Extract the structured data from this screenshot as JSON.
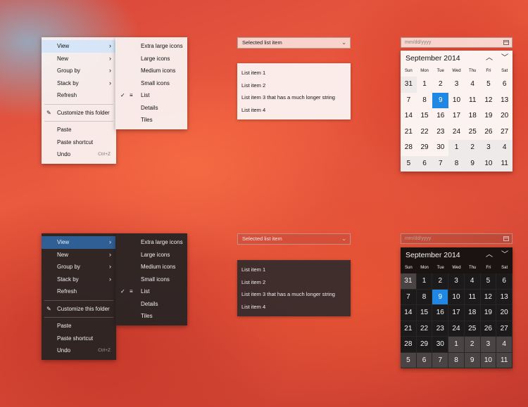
{
  "context_menu": {
    "items": [
      {
        "label": "View",
        "has_submenu": true,
        "highlighted": true
      },
      {
        "label": "New",
        "has_submenu": true
      },
      {
        "label": "Group by",
        "has_submenu": true
      },
      {
        "label": "Stack by",
        "has_submenu": true
      },
      {
        "label": "Refresh"
      },
      {
        "label": "Customize this folder",
        "icon": "customize-icon"
      },
      {
        "label": "Paste"
      },
      {
        "label": "Paste shortcut"
      },
      {
        "label": "Undo",
        "shortcut": "Ctrl+Z"
      }
    ]
  },
  "view_submenu": {
    "items": [
      {
        "label": "Extra large icons"
      },
      {
        "label": "Large icons"
      },
      {
        "label": "Medium icons"
      },
      {
        "label": "Small icons"
      },
      {
        "label": "List",
        "checked": true,
        "icon": "list-icon"
      },
      {
        "label": "Details"
      },
      {
        "label": "Tiles"
      }
    ]
  },
  "combo_box": {
    "selected": "Selected list item"
  },
  "list_box": {
    "items": [
      "List item 1",
      "List item 2",
      "List item 3 that has a much longer string",
      "List item 4"
    ]
  },
  "date_picker": {
    "placeholder": "mm/dd/yyyy",
    "month_label": "September 2014",
    "days_of_week": [
      "Sun",
      "Mon",
      "Tue",
      "Wed",
      "Thu",
      "Fri",
      "Sat"
    ],
    "weeks": [
      [
        "31",
        "1",
        "2",
        "3",
        "4",
        "5",
        "6"
      ],
      [
        "7",
        "8",
        "9",
        "10",
        "11",
        "12",
        "13"
      ],
      [
        "14",
        "15",
        "16",
        "17",
        "18",
        "19",
        "20"
      ],
      [
        "21",
        "22",
        "23",
        "24",
        "25",
        "26",
        "27"
      ],
      [
        "28",
        "29",
        "30",
        "1",
        "2",
        "3",
        "4"
      ],
      [
        "5",
        "6",
        "7",
        "8",
        "9",
        "10",
        "11"
      ]
    ],
    "today": "9",
    "prev_icon": "chevron-up-icon",
    "next_icon": "chevron-down-icon"
  },
  "colors": {
    "accent": "#1f87e4",
    "light_highlight": "#d6e6f8",
    "dark_highlight": "#2f5f95"
  }
}
